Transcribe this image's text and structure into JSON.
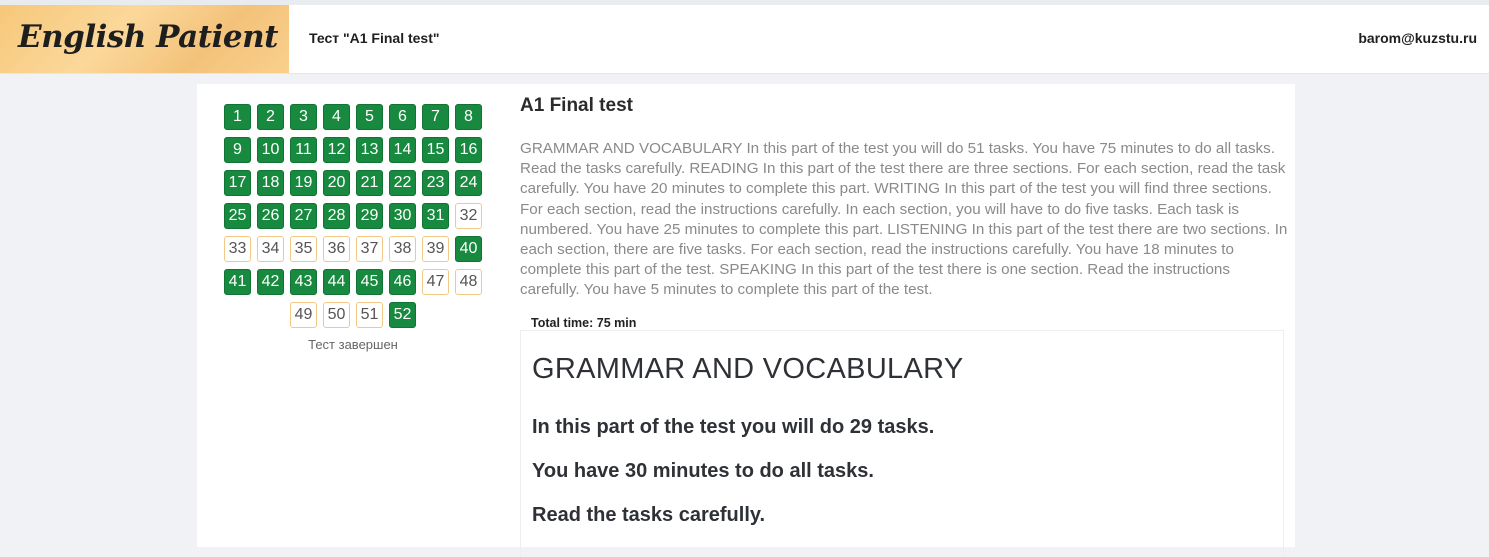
{
  "brand": {
    "name": "English Patient"
  },
  "header": {
    "test_title": "Тест \"A1 Final test\"",
    "user_email": "barom@kuzstu.ru"
  },
  "question_nav": {
    "rows": [
      [
        {
          "n": "1",
          "state": "done"
        },
        {
          "n": "2",
          "state": "done"
        },
        {
          "n": "3",
          "state": "done"
        },
        {
          "n": "4",
          "state": "done"
        },
        {
          "n": "5",
          "state": "done"
        },
        {
          "n": "6",
          "state": "done"
        },
        {
          "n": "7",
          "state": "done"
        },
        {
          "n": "8",
          "state": "done"
        }
      ],
      [
        {
          "n": "9",
          "state": "done"
        },
        {
          "n": "10",
          "state": "done"
        },
        {
          "n": "11",
          "state": "done"
        },
        {
          "n": "12",
          "state": "done"
        },
        {
          "n": "13",
          "state": "done"
        },
        {
          "n": "14",
          "state": "done"
        },
        {
          "n": "15",
          "state": "done"
        },
        {
          "n": "16",
          "state": "done"
        }
      ],
      [
        {
          "n": "17",
          "state": "done"
        },
        {
          "n": "18",
          "state": "done"
        },
        {
          "n": "19",
          "state": "done"
        },
        {
          "n": "20",
          "state": "done"
        },
        {
          "n": "21",
          "state": "done"
        },
        {
          "n": "22",
          "state": "done"
        },
        {
          "n": "23",
          "state": "done"
        },
        {
          "n": "24",
          "state": "done"
        }
      ],
      [
        {
          "n": "25",
          "state": "done"
        },
        {
          "n": "26",
          "state": "done"
        },
        {
          "n": "27",
          "state": "done"
        },
        {
          "n": "28",
          "state": "done"
        },
        {
          "n": "29",
          "state": "done"
        },
        {
          "n": "30",
          "state": "done"
        },
        {
          "n": "31",
          "state": "done"
        },
        {
          "n": "32",
          "state": "todo"
        }
      ],
      [
        {
          "n": "33",
          "state": "todo"
        },
        {
          "n": "34",
          "state": "todo"
        },
        {
          "n": "35",
          "state": "todo"
        },
        {
          "n": "36",
          "state": "todo"
        },
        {
          "n": "37",
          "state": "todo"
        },
        {
          "n": "38",
          "state": "todo"
        },
        {
          "n": "39",
          "state": "todo"
        },
        {
          "n": "40",
          "state": "done"
        }
      ],
      [
        {
          "n": "41",
          "state": "done"
        },
        {
          "n": "42",
          "state": "done"
        },
        {
          "n": "43",
          "state": "done"
        },
        {
          "n": "44",
          "state": "done"
        },
        {
          "n": "45",
          "state": "done"
        },
        {
          "n": "46",
          "state": "done"
        },
        {
          "n": "47",
          "state": "todo"
        },
        {
          "n": "48",
          "state": "todo"
        }
      ],
      [
        {
          "n": "49",
          "state": "todo"
        },
        {
          "n": "50",
          "state": "todo"
        },
        {
          "n": "51",
          "state": "todo"
        },
        {
          "n": "52",
          "state": "done"
        }
      ]
    ],
    "status_text": "Тест завершен",
    "colors": {
      "done": "#178a3f",
      "todo_border": "#f0c987"
    }
  },
  "main": {
    "title": "A1 Final test",
    "description": "GRAMMAR AND VOCABULARY In this part of the test you will do 51 tasks. You have 75 minutes to do all tasks. Read the tasks carefully. READING In this part of the test there are three sections. For each section, read the task carefully. You have 20 minutes to complete this part. WRITING In this part of the test you will find three sections. For each section, read the instructions carefully. In each section, you will have to do five tasks. Each task is numbered. You have 25 minutes to complete this part. LISTENING In this part of the test there are two sections. In each section, there are five tasks. For each section, read the instructions carefully. You have 18 minutes to complete this part of the test. SPEAKING In this part of the test there is one section. Read the instructions carefully. You have 5 minutes to complete this part of the test.",
    "total_time": "Total time: 75 min",
    "section": {
      "heading": "GRAMMAR AND VOCABULARY",
      "lines": [
        "In this part of the test you will do 29 tasks.",
        "You have 30 minutes to do all tasks.",
        "Read the tasks carefully."
      ]
    }
  }
}
